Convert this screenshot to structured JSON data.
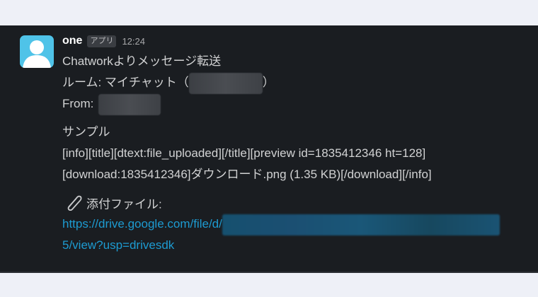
{
  "message": {
    "sender": "one",
    "badge": "アプリ",
    "time": "12:24",
    "lines": {
      "heading": "Chatworkよりメッセージ転送",
      "room_prefix": "ルーム: マイチャット（",
      "room_suffix": "）",
      "from_label": "From:",
      "sample": "サンプル",
      "info_line1": "[info][title][dtext:file_uploaded][/title][preview id=1835412346 ht=128]",
      "info_line2": "[download:1835412346]ダウンロード.png (1.35 KB)[/download][/info]",
      "attachment_label": "添付ファイル:",
      "link_part1": "https://drive.google.com/file/d/",
      "link_part2": "5/view?usp=drivesdk"
    }
  },
  "colors": {
    "background": "#1a1d21",
    "text": "#d1d2d3",
    "link": "#1d9bd1",
    "avatar": "#4fc3e8"
  },
  "icons": {
    "avatar": "person-silhouette-icon",
    "attachment": "paperclip-icon"
  }
}
